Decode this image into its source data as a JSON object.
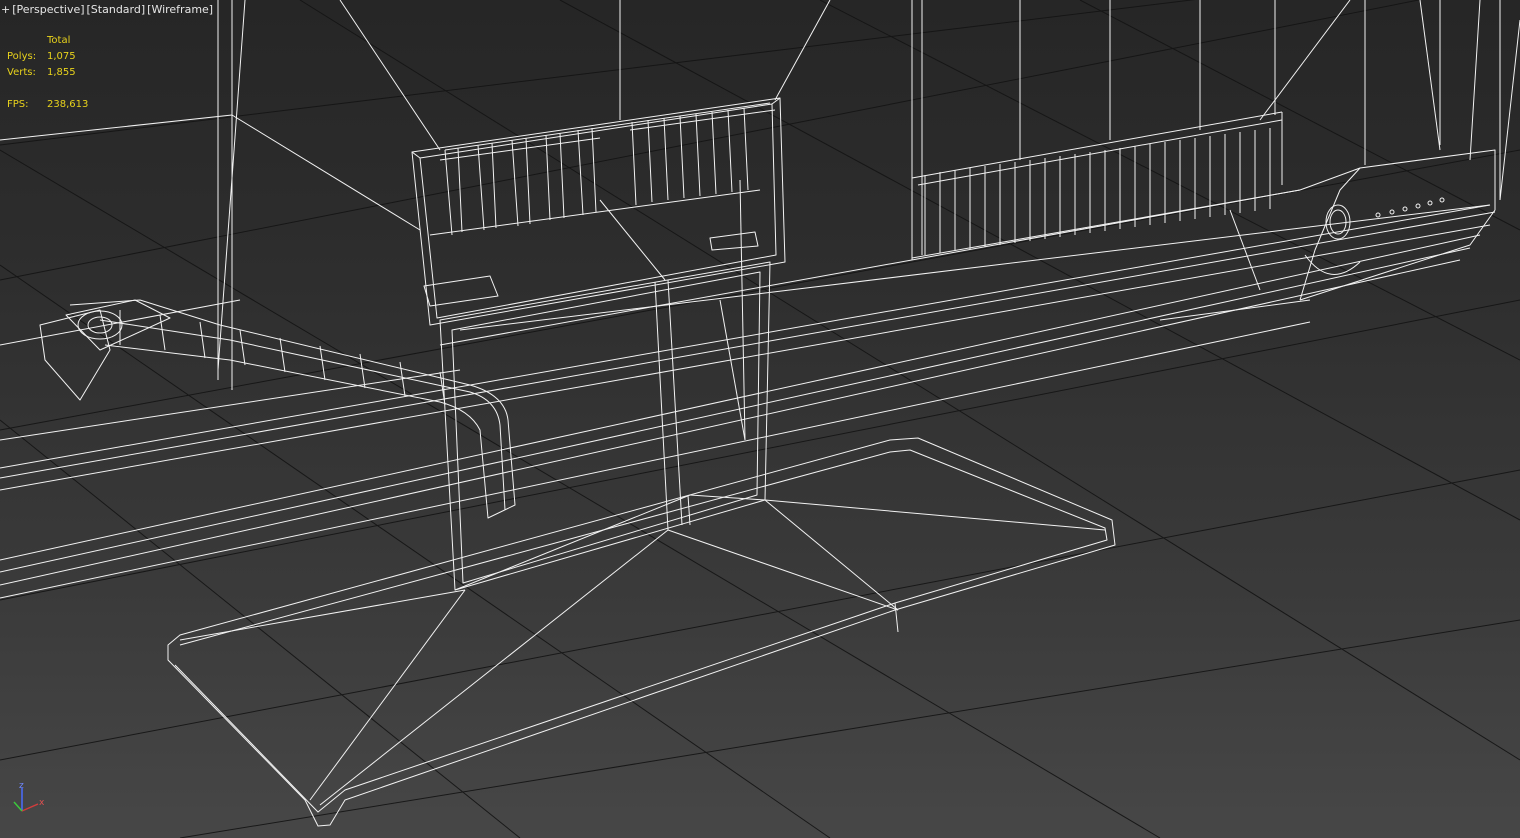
{
  "viewport": {
    "label_segments": [
      "+",
      "[Perspective]",
      "[Standard]",
      "[Wireframe]"
    ],
    "view": "Perspective",
    "shading": "Wireframe",
    "colors": {
      "background_top": "#262626",
      "background_bottom": "#474747",
      "grid": "#111111",
      "wireframe": "#f2f2f2",
      "stats_text": "#e8d21c"
    }
  },
  "stats": {
    "header": "Total",
    "polys_label": "Polys:",
    "polys_value": "1,075",
    "verts_label": "Verts:",
    "verts_value": "1,855",
    "fps_label": "FPS:",
    "fps_value": "238,613"
  },
  "gizmo": {
    "icon": "axis-tripod-icon",
    "z_label": "z",
    "x_label": "x",
    "colors": {
      "x": "#d23c3c",
      "y": "#3cc83c",
      "z": "#4a6cff"
    }
  }
}
